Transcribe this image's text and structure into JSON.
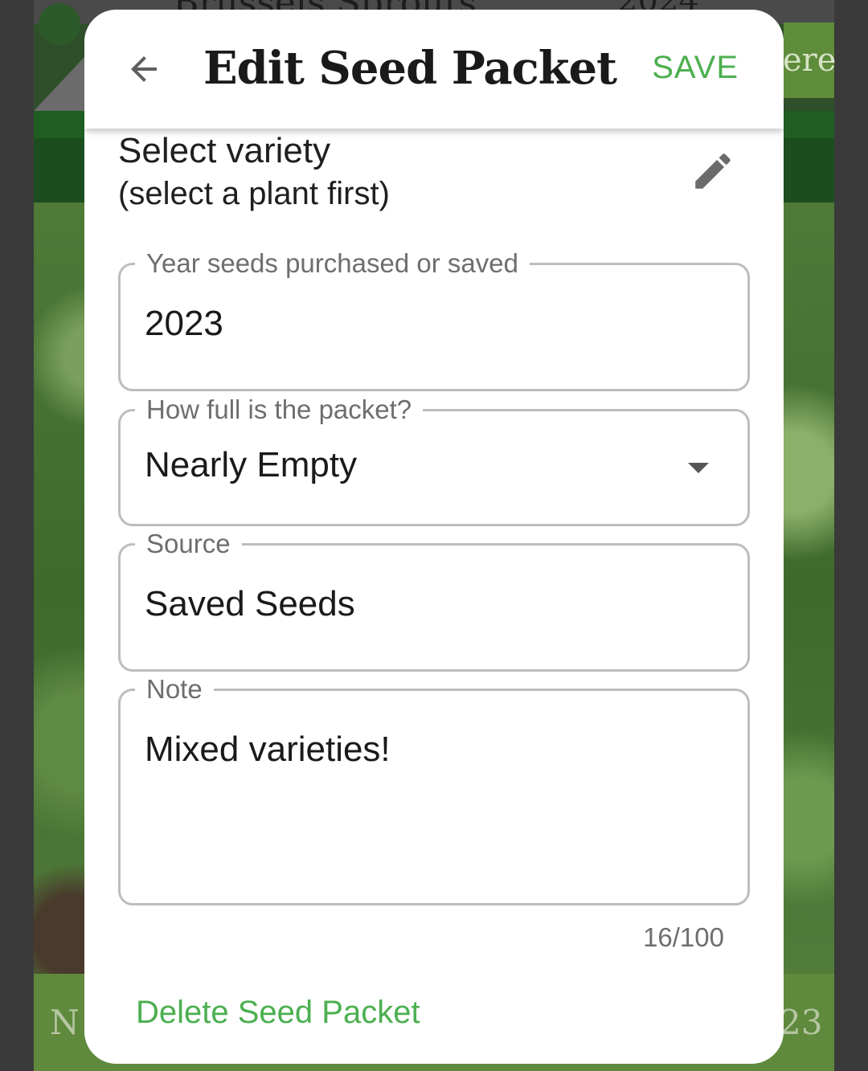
{
  "background": {
    "top_text": "Brussels Sprouts",
    "top_year": "2024",
    "right_text": "ere",
    "bottom_left_text": "N",
    "bottom_right_text": "23"
  },
  "dialog": {
    "title": "Edit Seed Packet",
    "back_icon": "arrow-back-icon",
    "save_label": "SAVE",
    "variety": {
      "label": "Select variety",
      "hint": "(select a plant first)",
      "edit_icon": "pencil-icon"
    },
    "fields": {
      "year": {
        "label": "Year seeds purchased or saved",
        "value": "2023"
      },
      "fullness": {
        "label": "How full is the packet?",
        "value": "Nearly Empty"
      },
      "source": {
        "label": "Source",
        "value": "Saved Seeds"
      },
      "note": {
        "label": "Note",
        "value": "Mixed varieties!",
        "counter": "16/100"
      }
    },
    "delete_label": "Delete Seed Packet"
  },
  "colors": {
    "accent": "#4caf50",
    "text": "#1a1a1a",
    "outline": "#bdbdbd",
    "label": "#6e6e6e"
  }
}
